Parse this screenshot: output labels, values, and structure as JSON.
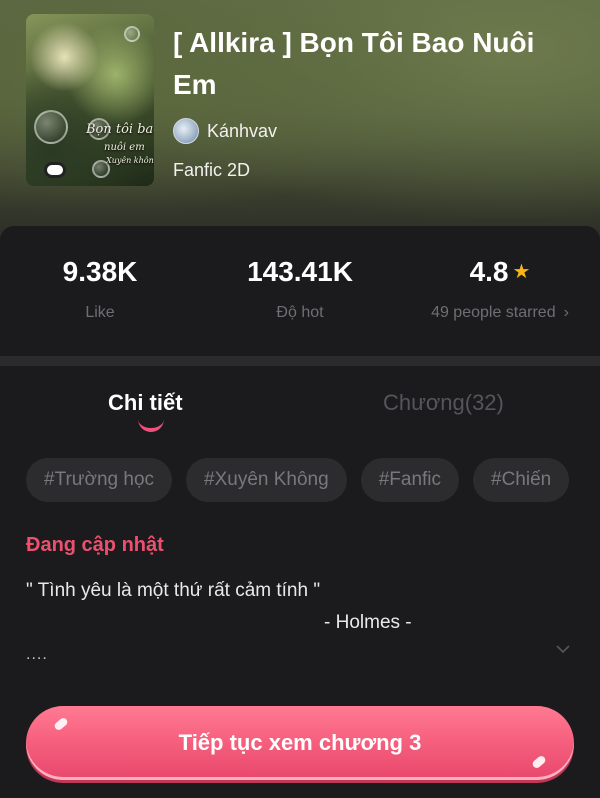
{
  "book": {
    "title": "[ Allkira ] Bọn Tôi Bao Nuôi Em",
    "author": "Kánhvav",
    "genre": "Fanfic 2D",
    "cover_text_1": "Bọn tôi bao",
    "cover_text_2": "nuôi em",
    "cover_text_3": "Xuyên không"
  },
  "stats": {
    "like_value": "9.38K",
    "like_label": "Like",
    "hot_value": "143.41K",
    "hot_label": "Độ hot",
    "rating_value": "4.8",
    "rating_label": "49 people starred",
    "star_icon": "★",
    "chevron": "›"
  },
  "tabs": {
    "detail": "Chi tiết",
    "chapters": "Chương(32)"
  },
  "tags": [
    "#Trường học",
    "#Xuyên Không",
    "#Fanfic",
    "#Chiến"
  ],
  "content": {
    "status": "Đang cập nhật",
    "desc_line1": "\" Tình yêu là một thứ rất cảm tính \"",
    "desc_line2": "- Holmes -",
    "desc_line3": "....",
    "expand_icon": "chevron-down-icon"
  },
  "cta": {
    "label": "Tiếp tục xem chương 3"
  },
  "colors": {
    "accent": "#ef4f6f",
    "star": "#f5b516",
    "background": "#1b1b1d"
  }
}
